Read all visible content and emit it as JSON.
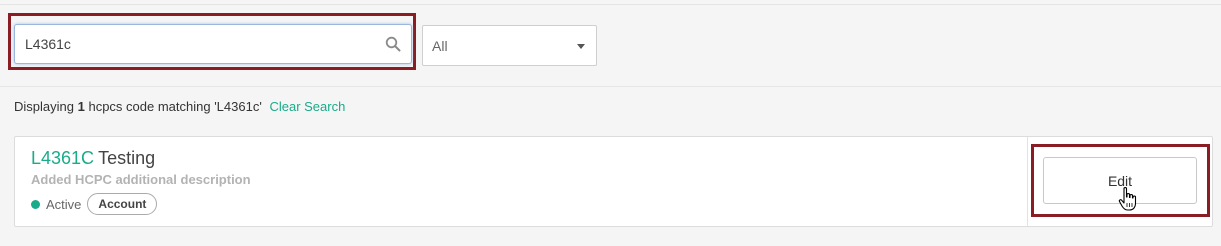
{
  "search": {
    "value": "L4361c",
    "icon": "search-icon"
  },
  "filter": {
    "selected": "All"
  },
  "results": {
    "prefix": "Displaying",
    "count": "1",
    "suffix": "hcpcs code matching 'L4361c'",
    "clear_label": "Clear Search"
  },
  "item": {
    "code": "L4361C",
    "title": "Testing",
    "description": "Added HCPC additional description",
    "status": "Active",
    "badge": "Account",
    "edit_label": "Edit"
  },
  "colors": {
    "accent": "#1aab8a",
    "highlight": "#8a1c24"
  }
}
